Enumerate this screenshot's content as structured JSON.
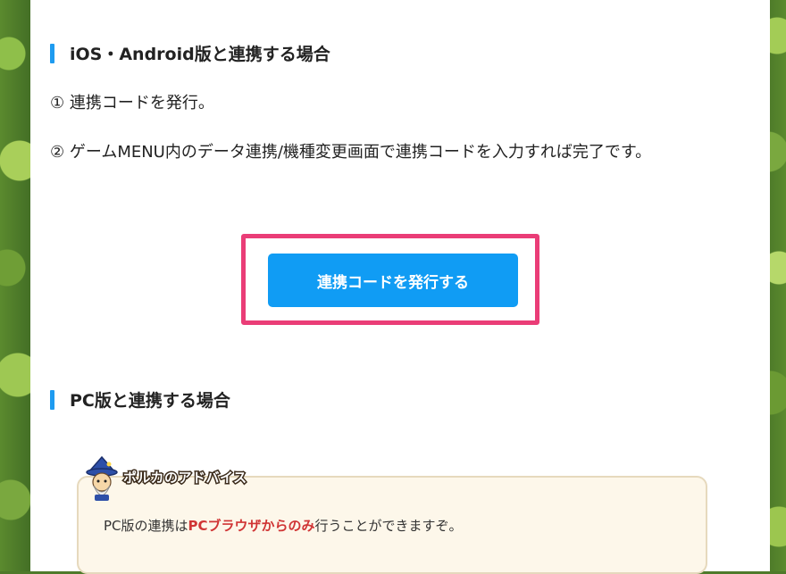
{
  "ios_section": {
    "heading": "iOS・Android版と連携する場合",
    "step1": "① 連携コードを発行。",
    "step2": "② ゲームMENU内のデータ連携/機種変更画面で連携コードを入力すれば完了です。",
    "issue_button_label": "連携コードを発行する"
  },
  "pc_section": {
    "heading": "PC版と連携する場合"
  },
  "advice": {
    "title": "ポルカのアドバイス",
    "text_before": "PC版の連携は",
    "text_emphasis": "PCブラウザからのみ",
    "text_after": "行うことができますぞ。"
  },
  "colors": {
    "accent_blue": "#109cf4",
    "heading_bar": "#1e9bf0",
    "highlight_pink": "#ea3d77",
    "emphasis_red": "#d03535"
  },
  "icons": {
    "mascot": "wizard-mascot-icon"
  }
}
